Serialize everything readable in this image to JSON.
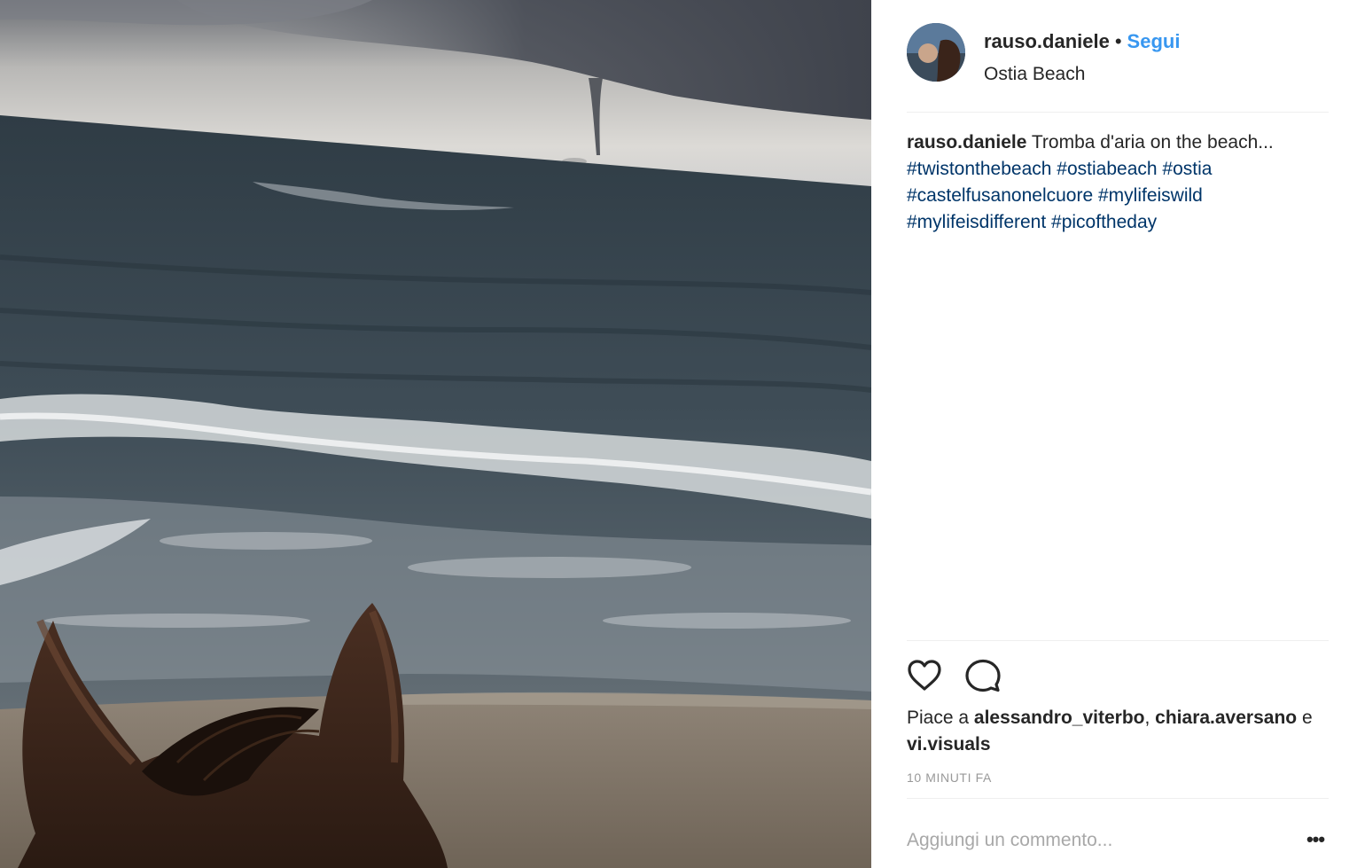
{
  "post": {
    "username": "rauso.daniele",
    "separator": "•",
    "follow_label": "Segui",
    "location": "Ostia Beach",
    "caption": {
      "username": "rauso.daniele",
      "text": "Tromba d'aria on the beach...",
      "hashtags": [
        "#twistonthebeach",
        "#ostiabeach",
        "#ostia",
        "#castelfusanonelcuore",
        "#mylifeiswild",
        "#mylifeisdifferent",
        "#picoftheday"
      ]
    },
    "likes": {
      "prefix": "Piace a",
      "user1": "alessandro_viterbo",
      "comma": ",",
      "user2": "chiara.aversano",
      "conjunction": "e",
      "user3": "vi.visuals"
    },
    "timestamp": "10 MINUTI FA",
    "comment_placeholder": "Aggiungi un commento...",
    "more_label": "•••"
  },
  "icons": {
    "like": "heart-icon",
    "comment": "comment-bubble-icon",
    "options": "more-options-icon"
  },
  "colors": {
    "follow_link": "#3897f0",
    "hashtag": "#003569",
    "timestamp": "#999999",
    "divider": "#efefef"
  }
}
